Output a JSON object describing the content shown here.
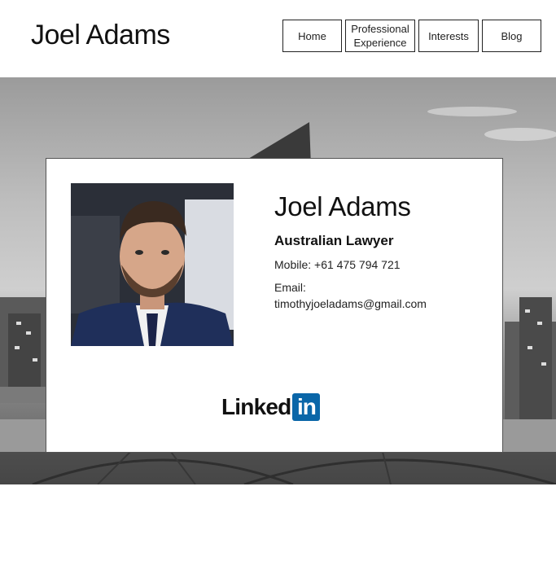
{
  "header": {
    "site_title": "Joel Adams",
    "nav": [
      {
        "label": "Home"
      },
      {
        "label": "Professional\nExperience"
      },
      {
        "label": "Interests"
      },
      {
        "label": "Blog"
      }
    ]
  },
  "profile": {
    "name": "Joel Adams",
    "role": "Australian Lawyer",
    "mobile": "Mobile: +61 475 794 721",
    "email_label": "Email:",
    "email": "timothyjoeladams@gmail.com",
    "photo_icon": "profile-photo"
  },
  "social": {
    "linkedin_text": "Linked",
    "linkedin_box": "in",
    "brand_color": "#0a66a8"
  }
}
